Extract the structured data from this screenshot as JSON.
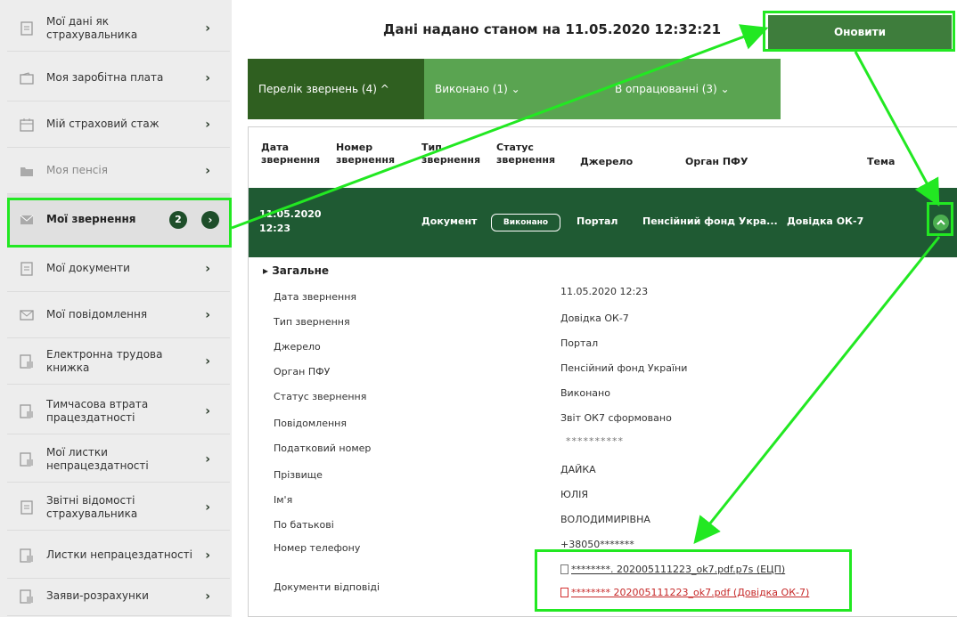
{
  "sidebar": {
    "items": [
      {
        "label": "Мої дані як страхувальника",
        "icon": "document-icon"
      },
      {
        "label": "Моя заробітна плата",
        "icon": "wallet-icon"
      },
      {
        "label": "Мій страховий стаж",
        "icon": "calendar-icon"
      },
      {
        "label": "Моя пенсія",
        "icon": "folder-icon"
      },
      {
        "label": "Мої звернення",
        "icon": "envelope-icon",
        "badge": "2"
      },
      {
        "label": "Мої документи",
        "icon": "document-icon"
      },
      {
        "label": "Мої повідомлення",
        "icon": "envelope-icon"
      },
      {
        "label": "Електронна трудова книжка",
        "icon": "book-icon"
      },
      {
        "label": "Тимчасова втрата працездатності",
        "icon": "sheet-icon"
      },
      {
        "label": "Мої листки непрацездатності",
        "icon": "sheet-icon"
      },
      {
        "label": "Звітні відомості страхувальника",
        "icon": "document-icon"
      },
      {
        "label": "Листки непрацездатності",
        "icon": "sheet-icon"
      },
      {
        "label": "Заяви-розрахунки",
        "icon": "sheet-icon"
      }
    ],
    "arrow": "›",
    "go": "›"
  },
  "header": {
    "title": "Дані надано станом на 11.05.2020 12:32:21",
    "refresh_label": "Оновити"
  },
  "tabs": [
    {
      "label": "Перелік звернень (4) ^"
    },
    {
      "label": "Виконано (1) ⌄"
    },
    {
      "label": "В опрацюванні (3) ⌄"
    }
  ],
  "table": {
    "headers": [
      "Дата звернення",
      "Номер звернення",
      "Тип звернення",
      "Статус звернення",
      "Джерело",
      "Орган ПФУ",
      "Тема"
    ],
    "row": {
      "date": "11.05.2020",
      "time": "12:23",
      "type": "Документ",
      "status": "Виконано",
      "source": "Портал",
      "organ": "Пенсійний фонд Укра...",
      "topic": "Довідка ОК-7"
    }
  },
  "details": {
    "section_title": "Загальне",
    "section_marker": "▸",
    "fields": [
      {
        "label": "Дата звернення",
        "value": "11.05.2020 12:23"
      },
      {
        "label": "Тип звернення",
        "value": "Довідка ОК-7"
      },
      {
        "label": "Джерело",
        "value": "Портал"
      },
      {
        "label": "Орган ПФУ",
        "value": "Пенсійний фонд України"
      },
      {
        "label": "Статус звернення",
        "value": "Виконано"
      },
      {
        "label": "Повідомлення",
        "value": "Звіт ОК7 сформовано"
      },
      {
        "label": "Податковий номер",
        "value": "**********"
      },
      {
        "label": "Прізвище",
        "value": "ДАЙКА"
      },
      {
        "label": "Ім'я",
        "value": "ЮЛІЯ"
      },
      {
        "label": "По батькові",
        "value": "ВОЛОДИМИРІВНА"
      },
      {
        "label": "Номер телефону",
        "value": "+38050*******"
      }
    ],
    "docs_label": "Документи відповіді",
    "docs": [
      {
        "label": "********. 202005111223_ok7.pdf.p7s (ЕЦП)"
      },
      {
        "label": "******** 202005111223_ok7.pdf (Довідка ОК-7)"
      }
    ]
  },
  "colors": {
    "sidebar_bg": "#ededed",
    "dark_green": "#1f5a33",
    "tab_green": "#5aa451",
    "tab_active": "#2f5f20",
    "button_green": "#3e7d3c",
    "highlight": "#22e822"
  }
}
